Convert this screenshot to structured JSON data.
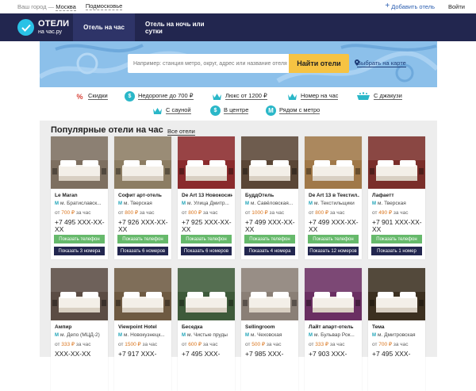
{
  "topbar": {
    "city_label": "Ваш город —",
    "city": "Москва",
    "region": "Подмосковье",
    "add_hotel": "Добавить отель",
    "login": "Войти"
  },
  "nav": {
    "logo_line1": "ОТЕЛИ",
    "logo_line2": "на час.ру",
    "tabs": [
      "Отель на час",
      "Отель на ночь или сутки"
    ]
  },
  "search": {
    "placeholder": "Например: станция метро, округ, адрес или название отеля",
    "button": "Найти отели",
    "map_link": "Выбрать на карте"
  },
  "filters": [
    {
      "label": "Скидки",
      "icon": "percent-icon"
    },
    {
      "label": "Недорогие до 700 ₽",
      "icon": "coin-icon"
    },
    {
      "label": "Люкс от 1200 ₽",
      "icon": "crown-icon"
    },
    {
      "label": "Номер на час",
      "icon": "crown-icon"
    },
    {
      "label": "С джакузи",
      "icon": "bathtub-icon"
    },
    {
      "label": "С сауной",
      "icon": "crown-icon"
    },
    {
      "label": "В центре",
      "icon": "coin-icon"
    },
    {
      "label": "Рядом с метро",
      "icon": "metro-icon"
    }
  ],
  "section": {
    "title": "Популярные отели на час",
    "all_link": "Все отели"
  },
  "hotels": [
    {
      "name": "Le Maran",
      "metro": "м. Братиславск...",
      "price_from": "от",
      "price": "700 ₽",
      "unit": "за час",
      "phone": "+7 495 XXX-XX-XX",
      "phone_btn": "Показать телефон",
      "rooms_btn": "Показать 3 номера",
      "photo": "#7d6f60"
    },
    {
      "name": "Софит арт-отель",
      "metro": "м. Тверская",
      "price_from": "от",
      "price": "800 ₽",
      "unit": "за час",
      "phone": "+7 926 XXX-XX-XX",
      "phone_btn": "Показать телефон",
      "rooms_btn": "Показать 6 номеров",
      "photo": "#8c7d63"
    },
    {
      "name": "De Art 13 Новокосин...",
      "metro": "м. Улица Дмитр...",
      "price_from": "от",
      "price": "800 ₽",
      "unit": "за час",
      "phone": "+7 925 XXX-XX-XX",
      "phone_btn": "Показать телефон",
      "rooms_btn": "Показать 6 номеров",
      "photo": "#8a2a2c"
    },
    {
      "name": "БуддОтель",
      "metro": "м. Савёловская...",
      "price_from": "от",
      "price": "1000 ₽",
      "unit": "за час",
      "phone": "+7 499 XXX-XX-XX",
      "phone_btn": "Показать телефон",
      "rooms_btn": "Показать 4 номера",
      "photo": "#5a4636"
    },
    {
      "name": "De Art 13 в Текстил...",
      "metro": "м. Текстильщики",
      "price_from": "от",
      "price": "800 ₽",
      "unit": "за час",
      "phone": "+7 499 XXX-XX-XX",
      "phone_btn": "Показать телефон",
      "rooms_btn": "Показать 12 номеров",
      "photo": "#a07848"
    },
    {
      "name": "Лафаетт",
      "metro": "м. Тверская",
      "price_from": "от",
      "price": "490 ₽",
      "unit": "за час",
      "phone": "+7 901 XXX-XX-XX",
      "phone_btn": "Показать телефон",
      "rooms_btn": "Показать 1 номер",
      "photo": "#7a2e2a"
    },
    {
      "name": "Ампир",
      "metro": "м. Депо (МЦД-2)",
      "price_from": "от",
      "price": "333 ₽",
      "unit": "за час",
      "phone": "XXX-XX-XX",
      "phone_btn": "",
      "rooms_btn": "",
      "photo": "#5b4c44"
    },
    {
      "name": "Viewpoint Hotel",
      "metro": "м. Новокузнецк...",
      "price_from": "от",
      "price": "1500 ₽",
      "unit": "за час",
      "phone": "+7 917 XXX-",
      "phone_btn": "",
      "rooms_btn": "",
      "photo": "#6e5a42"
    },
    {
      "name": "Беседка",
      "metro": "м. Чистые пруды",
      "price_from": "от",
      "price": "600 ₽",
      "unit": "за час",
      "phone": "+7 495 XXX-",
      "phone_btn": "",
      "rooms_btn": "",
      "photo": "#3e5a3a"
    },
    {
      "name": "Sellingroom",
      "metro": "м. Чеховская",
      "price_from": "от",
      "price": "500 ₽",
      "unit": "за час",
      "phone": "+7 985 XXX-",
      "phone_btn": "",
      "rooms_btn": "",
      "photo": "#8a7f76"
    },
    {
      "name": "Лайт апарт-отель",
      "metro": "м. Бульвар Рок...",
      "price_from": "от",
      "price": "333 ₽",
      "unit": "за час",
      "phone": "+7 903 XXX-",
      "phone_btn": "",
      "rooms_btn": "",
      "photo": "#6a2f62"
    },
    {
      "name": "Тема",
      "metro": "м. Дмитровская",
      "price_from": "от",
      "price": "700 ₽",
      "unit": "за час",
      "phone": "+7 495 XXX-",
      "phone_btn": "",
      "rooms_btn": "",
      "photo": "#3c3020"
    }
  ],
  "colors": {
    "nav_bg": "#22264f",
    "accent_yellow": "#f6c343",
    "green_button": "#66b96b",
    "price_orange": "#d9731a",
    "coin_teal": "#2ab7c8"
  }
}
